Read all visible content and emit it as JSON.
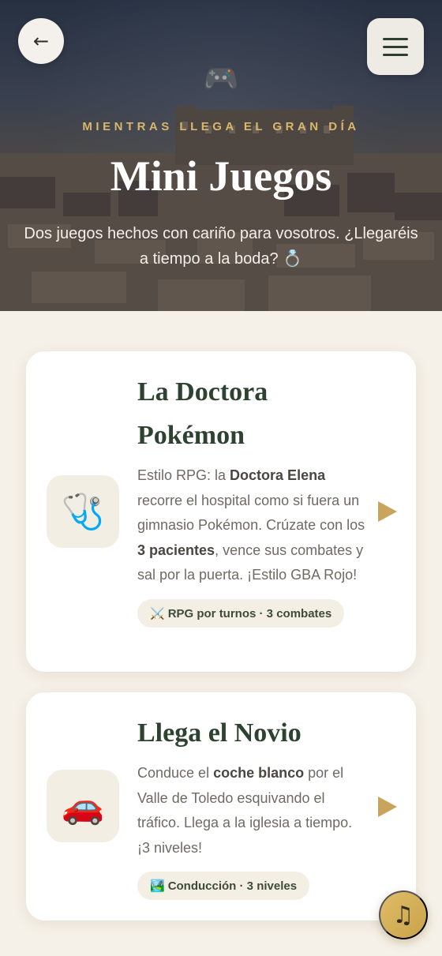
{
  "header": {
    "back_icon": "←",
    "menu_icon": "hamburger-menu-icon",
    "game_icon": "🎮",
    "eyebrow": "MIENTRAS LLEGA EL GRAN DÍA",
    "title": "Mini Juegos",
    "subtitle": "Dos juegos hechos con cariño para vosotros. ¿Llegaréis a tiempo a la boda? 💍"
  },
  "games": [
    {
      "icon": "🩺",
      "title": "La Doctora Pokémon",
      "desc_parts": [
        "Estilo RPG: la ",
        "Doctora Elena",
        " recorre el hospital como si fuera un gimnasio Pokémon. Crúzate con los ",
        "3 pacientes",
        ", vence sus combates y sal por la puerta. ¡Estilo GBA Rojo!"
      ],
      "tag_icon": "⚔️",
      "tag": "RPG por turnos · 3 combates"
    },
    {
      "icon": "🚗",
      "title": "Llega el Novio",
      "desc_parts": [
        "Conduce el ",
        "coche blanco",
        " por el Valle de Toledo esquivando el tráfico. Llega a la iglesia a tiempo. ¡3 niveles!"
      ],
      "tag_icon": "🏞️",
      "tag": "Conducción · 3 niveles"
    }
  ],
  "music_icon": "♫",
  "colors": {
    "accent": "#d8b66c",
    "title": "#2e4230",
    "play": "#c9a45c",
    "card_bg": "#ffffff",
    "page_bg": "#f6f1e8"
  }
}
